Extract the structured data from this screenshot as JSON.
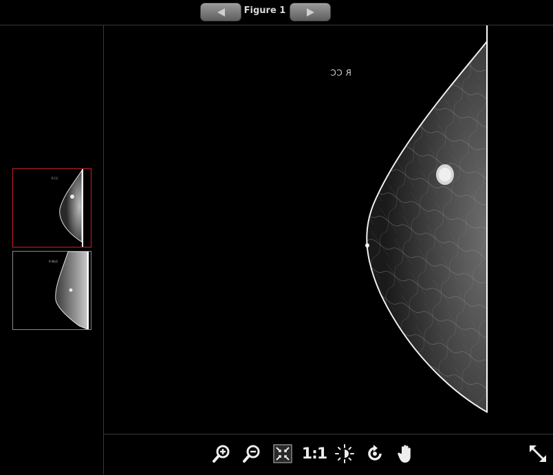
{
  "header": {
    "title": "Figure 1",
    "prev_icon": "triangle-left-icon",
    "next_icon": "triangle-right-icon"
  },
  "thumbnails": [
    {
      "label": "R CC",
      "selected": true
    },
    {
      "label": "R MLO",
      "selected": false
    }
  ],
  "viewer": {
    "view_label": "R CC"
  },
  "toolbar": {
    "tools": [
      {
        "name": "zoom-in-icon"
      },
      {
        "name": "zoom-out-icon"
      },
      {
        "name": "fit-to-screen-icon"
      },
      {
        "name": "actual-size",
        "label": "1:1"
      },
      {
        "name": "brightness-icon"
      },
      {
        "name": "rotate-icon"
      },
      {
        "name": "pan-hand-icon"
      },
      {
        "name": "fullscreen-expand-icon"
      }
    ]
  },
  "colors": {
    "background": "#000000",
    "selected_border": "#d0202a",
    "divider": "#3a3a3a"
  }
}
